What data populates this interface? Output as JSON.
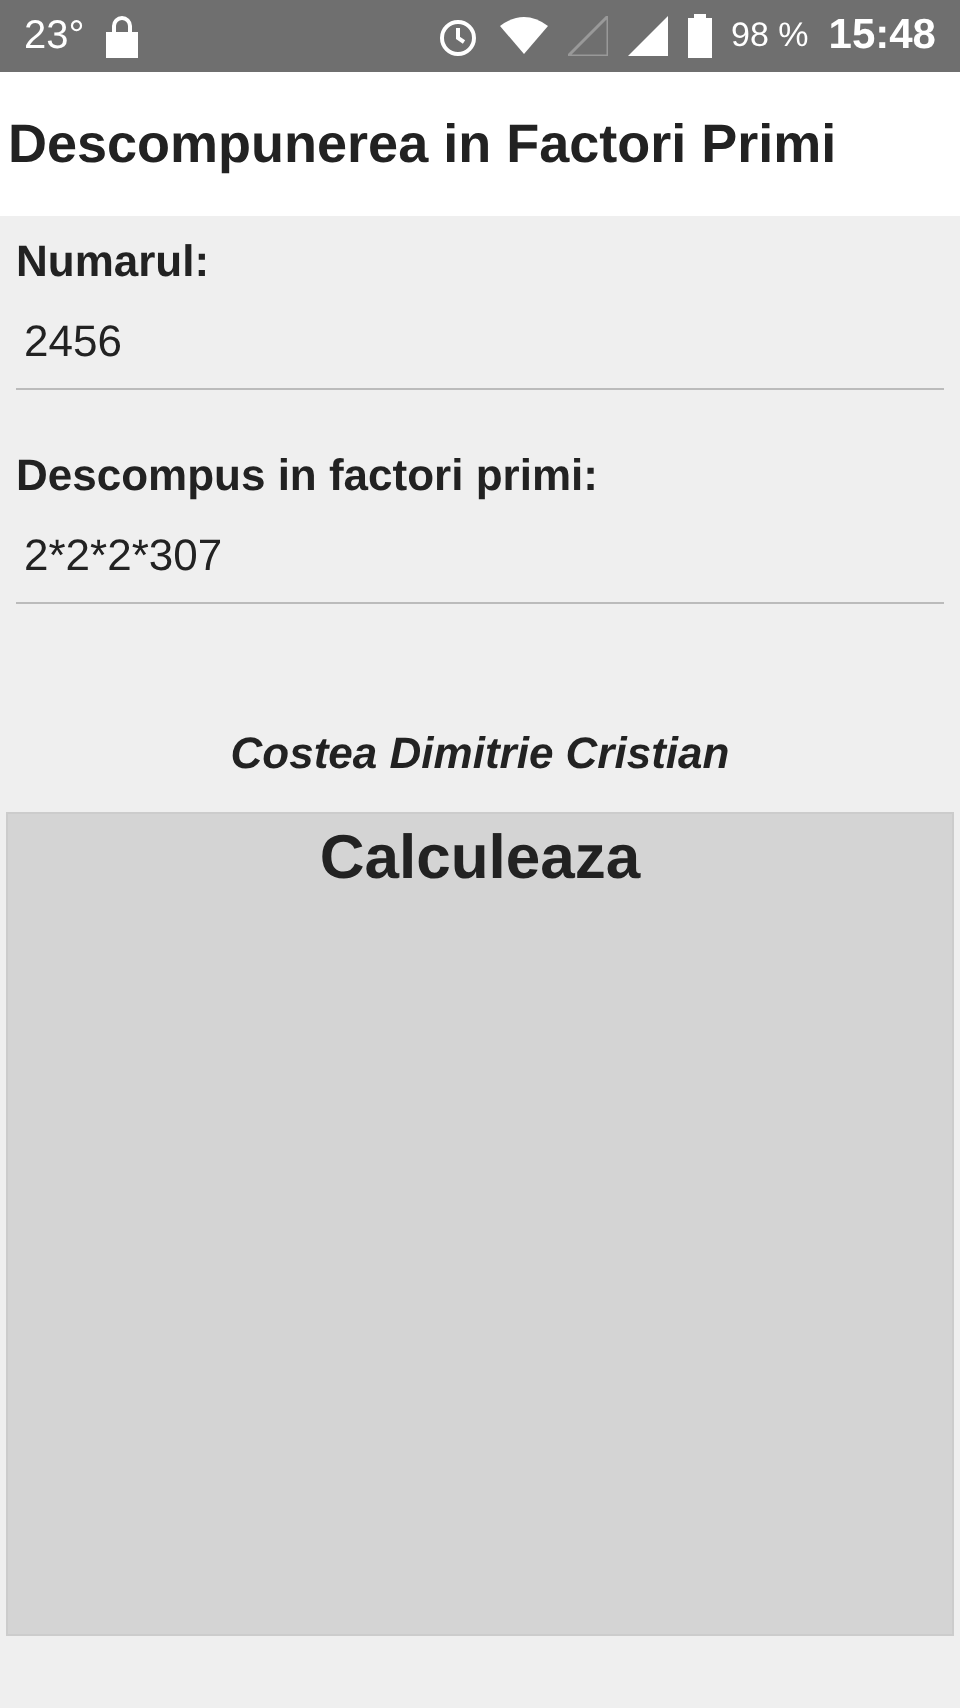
{
  "status_bar": {
    "temperature": "23°",
    "battery": "98 %",
    "time": "15:48"
  },
  "title": "Descompunerea in Factori Primi",
  "fields": [
    {
      "label": "Numarul:",
      "value": "2456"
    },
    {
      "label": "Descompus in factori primi:",
      "value": "2*2*2*307"
    }
  ],
  "author": "Costea Dimitrie Cristian",
  "button": "Calculeaza"
}
